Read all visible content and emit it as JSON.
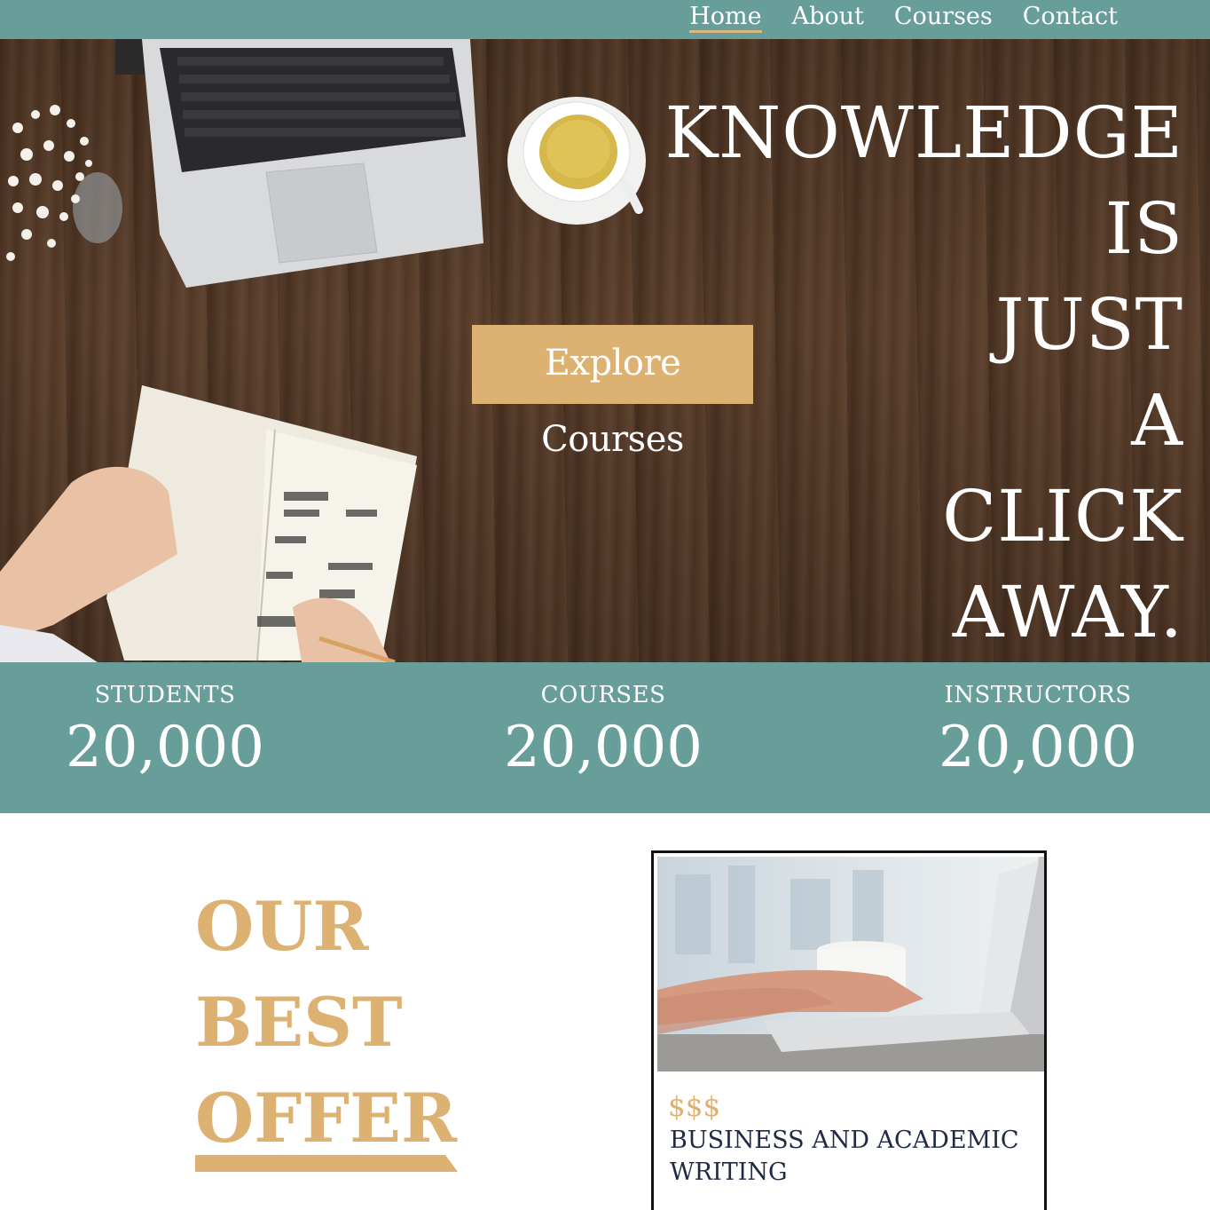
{
  "nav": {
    "items": [
      {
        "label": "Home",
        "active": true
      },
      {
        "label": "About",
        "active": false
      },
      {
        "label": "Courses",
        "active": false
      },
      {
        "label": "Contact",
        "active": false
      }
    ]
  },
  "hero": {
    "title_lines": [
      "KNOWLEDGE",
      "IS",
      "JUST",
      "A",
      "CLICK",
      "AWAY."
    ],
    "cta_label": "Explore Courses"
  },
  "stats": [
    {
      "label": "STUDENTS",
      "value": "20,000"
    },
    {
      "label": "COURSES",
      "value": "20,000"
    },
    {
      "label": "INSTRUCTORS",
      "value": "20,000"
    }
  ],
  "offer": {
    "title_lines": [
      "OUR",
      "BEST",
      "OFFER"
    ]
  },
  "course_card": {
    "price": "$$$",
    "title": "BUSINESS AND ACADEMIC WRITING"
  },
  "colors": {
    "teal": "#679e99",
    "gold": "#dcb172",
    "navy": "#1f2a44"
  }
}
